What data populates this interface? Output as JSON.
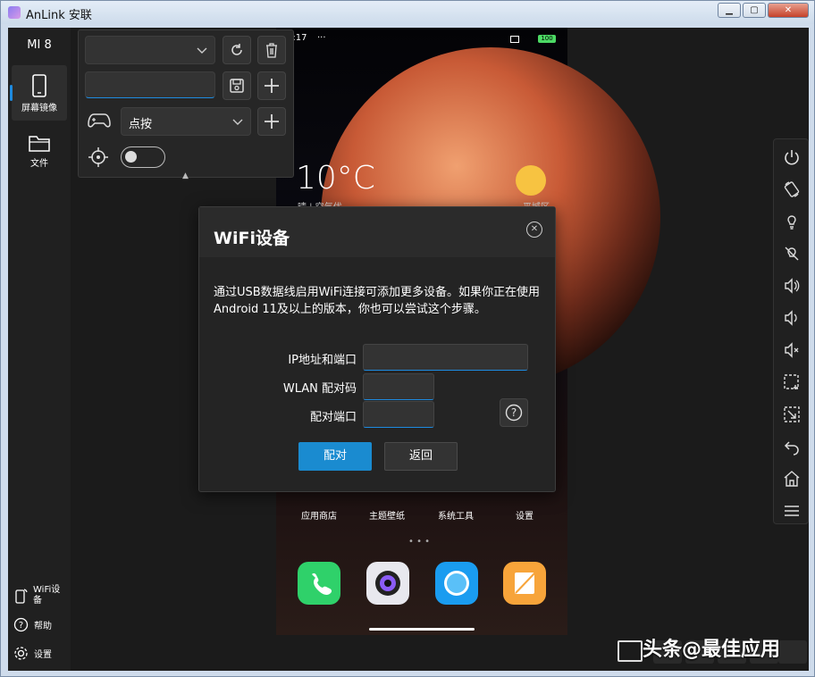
{
  "window": {
    "title": "AnLink 安联",
    "minimize": "▁",
    "maximize": "▢",
    "close": "✕"
  },
  "sidebar": {
    "device_name": "MI 8",
    "items": [
      {
        "label": "屏幕镜像",
        "icon": "phone-icon"
      },
      {
        "label": "文件",
        "icon": "folder-icon"
      }
    ],
    "bottom": [
      {
        "label": "WiFi设备",
        "icon": "wifi-device-icon"
      },
      {
        "label": "帮助",
        "icon": "help-icon"
      },
      {
        "label": "设置",
        "icon": "gear-icon"
      }
    ]
  },
  "control_panel": {
    "preset_select": "",
    "name_input": "",
    "mode_select": "点按",
    "crosshair_toggle": false
  },
  "phone": {
    "time": "2:17",
    "temperature": "10°C",
    "weather_sub": "晴 | 空气优",
    "weather_right": "平城区",
    "apps": [
      "应用商店",
      "主题壁纸",
      "系统工具",
      "设置"
    ],
    "battery": "100"
  },
  "dialog": {
    "title": "WiFi设备",
    "description": "通过USB数据线启用WiFi连接可添加更多设备。如果你正在使用Android 11及以上的版本，你也可以尝试这个步骤。",
    "fields": [
      {
        "label": "IP地址和端口",
        "value": ""
      },
      {
        "label": "WLAN 配对码",
        "value": ""
      },
      {
        "label": "配对端口",
        "value": ""
      }
    ],
    "pair_button": "配对",
    "back_button": "返回"
  },
  "watermark": "头条@最佳应用",
  "colors": {
    "accent": "#1a8bd0",
    "background": "#1b1b1b",
    "panel": "#262626"
  }
}
